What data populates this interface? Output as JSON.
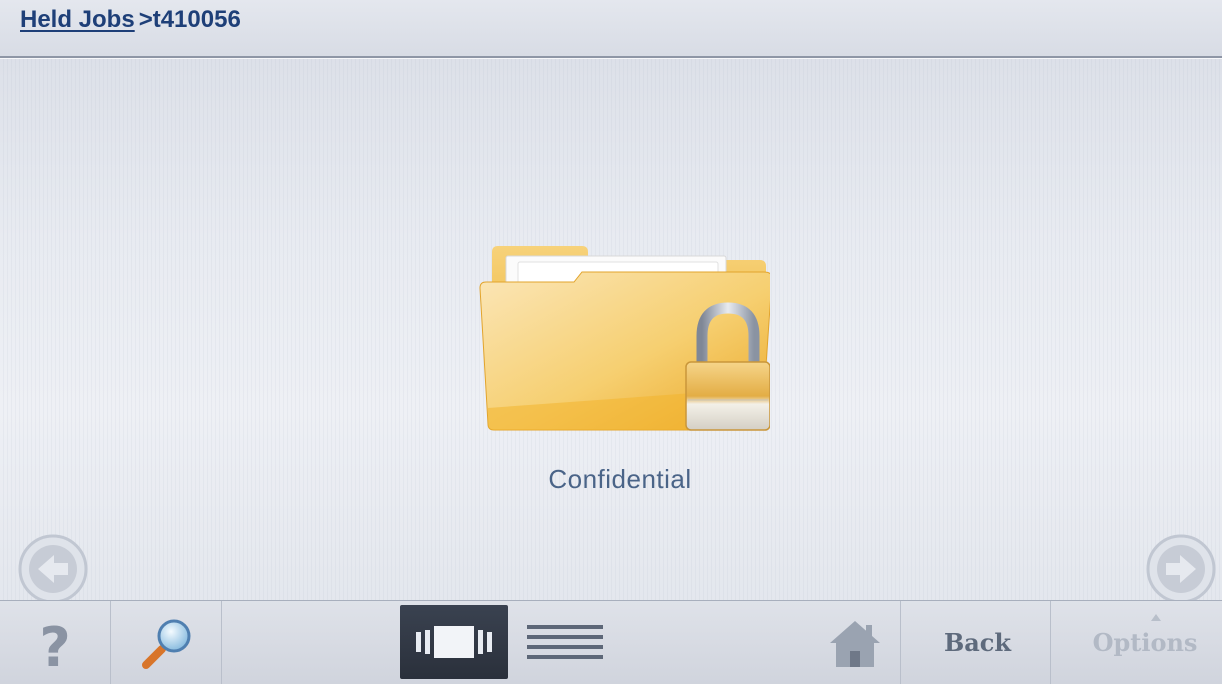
{
  "header": {
    "breadcrumb_parent": "Held Jobs",
    "breadcrumb_current": ">t410056"
  },
  "main": {
    "job": {
      "label": "Confidential",
      "icon": "locked-folder-icon"
    },
    "nav": {
      "prev_icon": "arrow-left-icon",
      "next_icon": "arrow-right-icon"
    }
  },
  "footer": {
    "help_label": "?",
    "search_icon": "magnifier-icon",
    "icon_view_icon": "icon-view-icon",
    "list_view_icon": "list-view-icon",
    "home_icon": "home-icon",
    "back_label": "Back",
    "options_label": "Options"
  },
  "colors": {
    "breadcrumb": "#1e3f78",
    "job_label": "#4a6488",
    "folder_gold": "#f0b531",
    "footer_bg": "#d6dae2",
    "selected_view": "#2f3642"
  }
}
